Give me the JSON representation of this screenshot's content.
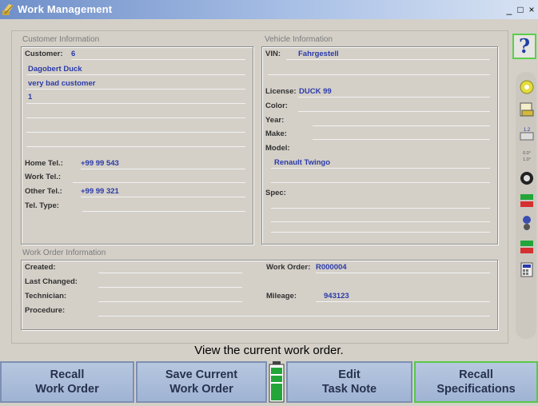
{
  "window": {
    "title": "Work Management",
    "controls": {
      "minimize": "_",
      "maximize": "□",
      "close": "×"
    }
  },
  "customer": {
    "group_label": "Customer Information",
    "customer_label": "Customer:",
    "customer_value": "6",
    "address_lines": [
      "Dagobert Duck",
      "very bad customer",
      "1",
      "",
      "",
      ""
    ],
    "home_tel_label": "Home Tel.:",
    "home_tel_value": "+99 99 543",
    "work_tel_label": "Work Tel.:",
    "work_tel_value": "",
    "other_tel_label": "Other Tel.:",
    "other_tel_value": "+99 99 321",
    "tel_type_label": "Tel. Type:",
    "tel_type_value": ""
  },
  "vehicle": {
    "group_label": "Vehicle Information",
    "vin_label": "VIN:",
    "vin_value": "Fahrgestell",
    "license_label": "License:",
    "license_value": "DUCK 99",
    "color_label": "Color:",
    "year_label": "Year:",
    "make_label": "Make:",
    "model_label": "Model:",
    "model_value": "Renault Twingo",
    "spec_label": "Spec:"
  },
  "work_order": {
    "group_label": "Work Order Information",
    "created_label": "Created:",
    "last_changed_label": "Last Changed:",
    "technician_label": "Technician:",
    "procedure_label": "Procedure:",
    "work_order_label": "Work Order:",
    "work_order_value": "R000004",
    "mileage_label": "Mileage:",
    "mileage_value": "943123"
  },
  "toolbar": {
    "help_glyph": "?",
    "icons": [
      "alignment-icon",
      "printer-icon",
      "specs-icon",
      "readings-icon",
      "wheel-icon",
      "battery-status-icon",
      "tire-icon",
      "battery-status-icon",
      "calculator-icon"
    ]
  },
  "status_text": "View the current work order.",
  "buttons": {
    "recall_work_order": [
      "Recall",
      "Work Order"
    ],
    "save_work_order": [
      "Save Current",
      "Work Order"
    ],
    "edit_task_note": [
      "Edit",
      "Task Note"
    ],
    "recall_specifications": [
      "Recall",
      "Specifications"
    ]
  },
  "colors": {
    "title_bar_start": "#6f8fc9",
    "value_text": "#2b3aa8",
    "button_face": "#a9bbd8",
    "highlight_border": "#58c84a"
  }
}
